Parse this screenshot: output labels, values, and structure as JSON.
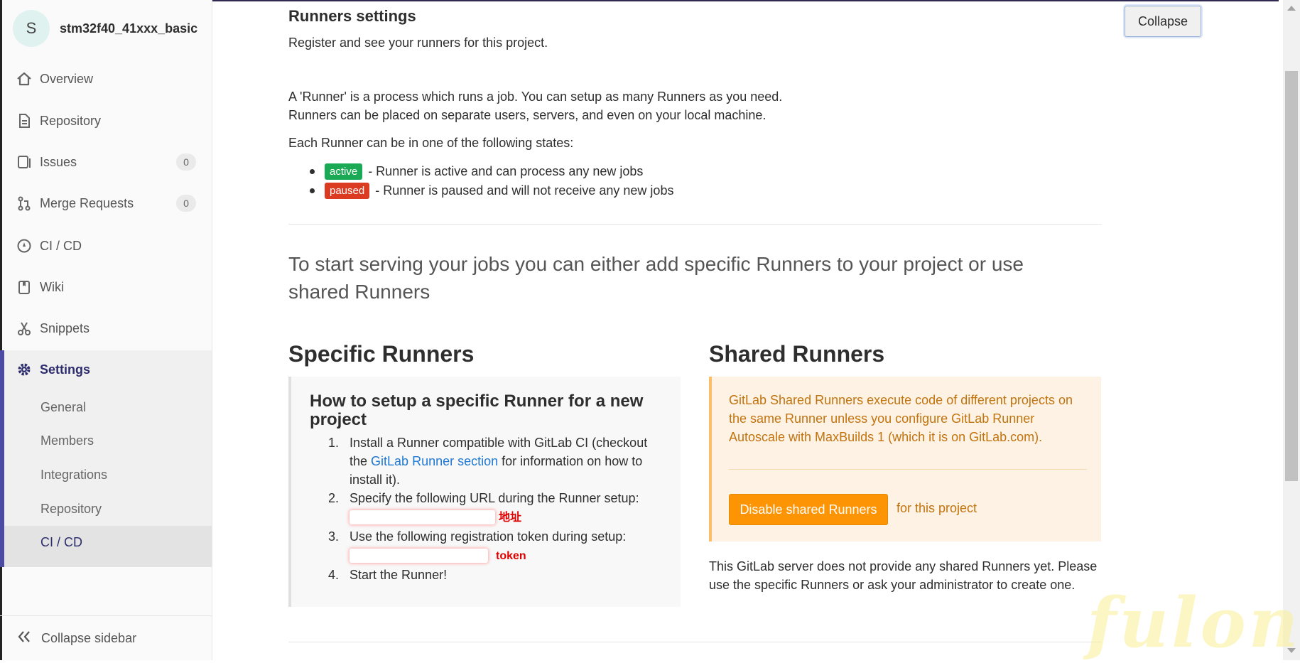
{
  "sidebar": {
    "project_initial": "S",
    "project_name": "stm32f40_41xxx_basic",
    "items": [
      {
        "label": "Overview",
        "icon": "home-icon"
      },
      {
        "label": "Repository",
        "icon": "doc-icon"
      },
      {
        "label": "Issues",
        "icon": "issues-icon",
        "count": "0"
      },
      {
        "label": "Merge Requests",
        "icon": "merge-request-icon",
        "count": "0"
      },
      {
        "label": "CI / CD",
        "icon": "rocket-icon"
      },
      {
        "label": "Wiki",
        "icon": "book-icon"
      },
      {
        "label": "Snippets",
        "icon": "scissors-icon"
      },
      {
        "label": "Settings",
        "icon": "gear-icon"
      }
    ],
    "settings_sub": [
      "General",
      "Members",
      "Integrations",
      "Repository",
      "CI / CD"
    ],
    "collapse_label": "Collapse sidebar"
  },
  "main": {
    "section_title": "Runners settings",
    "section_desc": "Register and see your runners for this project.",
    "collapse_button": "Collapse",
    "intro_line1": "A 'Runner' is a process which runs a job. You can setup as many Runners as you need.",
    "intro_line2": "Runners can be placed on separate users, servers, and even on your local machine.",
    "states_intro": "Each Runner can be in one of the following states:",
    "states": [
      {
        "badge": "active",
        "desc": "- Runner is active and can process any new jobs",
        "color": "#1aaa55"
      },
      {
        "badge": "paused",
        "desc": "- Runner is paused and will not receive any new jobs",
        "color": "#db3b21"
      }
    ],
    "lead": "To start serving your jobs you can either add specific Runners to your project or use shared Runners",
    "specific": {
      "title": "Specific Runners",
      "box_title": "How to setup a specific Runner for a new project",
      "step1_a": "Install a Runner compatible with GitLab CI (checkout the ",
      "step1_link": "GitLab Runner section",
      "step1_b": " for information on how to install it).",
      "step2": "Specify the following URL during the Runner setup:",
      "step2_annotation": "地址",
      "step3": "Use the following registration token during setup:",
      "step3_annotation": "token",
      "step4": "Start the Runner!"
    },
    "shared": {
      "title": "Shared Runners",
      "warning": "GitLab Shared Runners execute code of different projects on the same Runner unless you configure GitLab Runner Autoscale with MaxBuilds 1 (which it is on GitLab.com).",
      "disable_button": "Disable shared Runners",
      "for_project": "for this project",
      "note": "This GitLab server does not provide any shared Runners yet. Please use the specific Runners or ask your administrator to create one."
    }
  },
  "watermark": "fulong",
  "colors": {
    "accent": "#4b4ba3",
    "warning_bg": "#fdf2e4",
    "warning_text": "#c2730d",
    "button_orange": "#fc9403",
    "link": "#1f78d1"
  }
}
